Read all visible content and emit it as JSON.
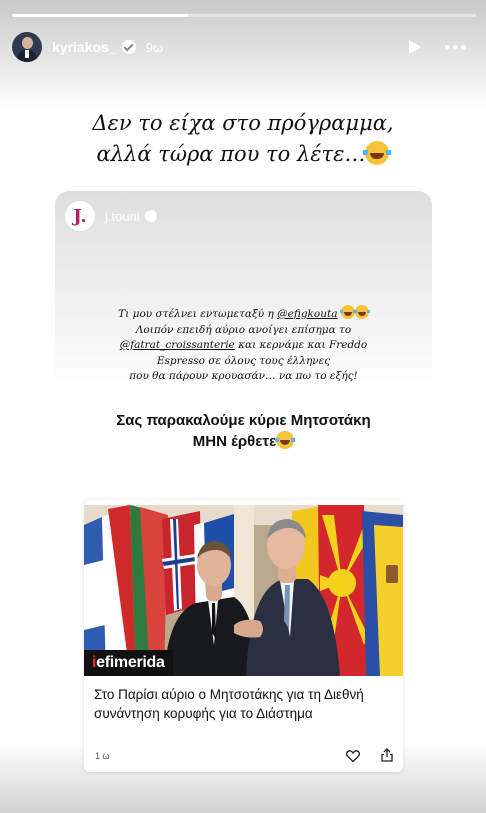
{
  "story": {
    "progress": 0.38,
    "username": "kyriakos_",
    "time_ago": "9ω",
    "caption_line1": "Δεν το είχα στο πρόγραμμα,",
    "caption_line2": "αλλά τώρα που το λέτε…",
    "icons": [
      "avatar",
      "verified-icon",
      "play-icon",
      "more-icon",
      "laughing-emoji"
    ]
  },
  "reshare": {
    "avatar_letter": "J.",
    "username": "j.touni",
    "line1_prefix": "Τι μου στέλνει εντωμεταξύ η ",
    "mention1": "@efigkouta",
    "line2": "Λοιπόν επειδή αύριο ανοίγει επίσημα το",
    "mention2": "@fatrat_croissanterie",
    "line3_suffix": " και κερνάμε και Freddo",
    "line4": "Espresso σε όλους τους έλληνες",
    "line5": "που θα πάρουν κρουασάν… να πω το εξής!",
    "bold_line1": "Σας παρακαλούμε κύριε Μητσοτάκη",
    "bold_line2": "ΜΗΝ έρθετε"
  },
  "news_card": {
    "logo_accent": "i",
    "logo_rest": "efimerida",
    "title": "Στο Παρίσι αύριο ο Μητσοτάκης για τη Διεθνή συνάντηση κορυφής για το Διάστημα",
    "age": "1 ω",
    "icons": [
      "heart-icon",
      "share-icon"
    ]
  },
  "colors": {
    "logo_red": "#e0332f",
    "reshare_avatar": "#b0265a"
  }
}
